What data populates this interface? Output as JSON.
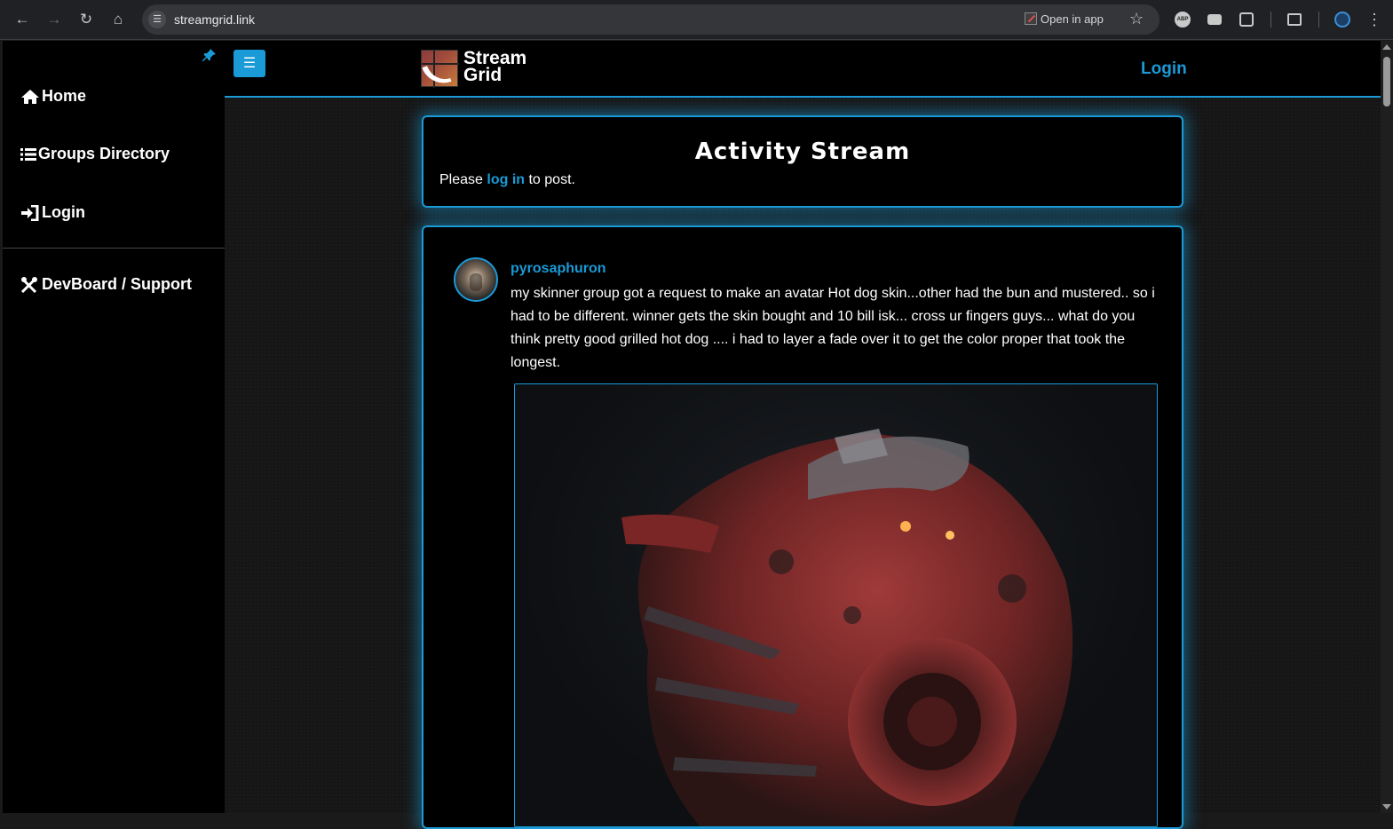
{
  "browser": {
    "url": "streamgrid.link",
    "open_in_app": "Open in app",
    "abp_label": "ABP",
    "icons": [
      "back-icon",
      "forward-icon",
      "reload-icon",
      "home-icon",
      "site-info-icon",
      "star-icon",
      "extensions-icon",
      "menu-icon"
    ]
  },
  "sidebar": {
    "items": [
      {
        "label": "Home",
        "icon": "home-icon"
      },
      {
        "label": "Groups Directory",
        "icon": "list-icon"
      },
      {
        "label": "Login",
        "icon": "sign-in-icon"
      },
      {
        "label": "DevBoard / Support",
        "icon": "tools-icon"
      }
    ]
  },
  "header": {
    "logo_line1": "Stream",
    "logo_line2": "Grid",
    "login_label": "Login",
    "accent_color": "#1a9ad6"
  },
  "activity": {
    "title": "Activity Stream",
    "msg_before": "Please",
    "msg_link": "log in",
    "msg_after": "to post."
  },
  "post": {
    "author": "pyrosaphuron",
    "body": "my skinner group got a request to make an avatar Hot dog skin...other had the bun and mustered.. so i had to be different. winner gets the skin bought and 10 bill isk... cross ur fingers guys... what do you think pretty good grilled hot dog .... i had to layer a fade over it to get the color proper that took the longest."
  }
}
